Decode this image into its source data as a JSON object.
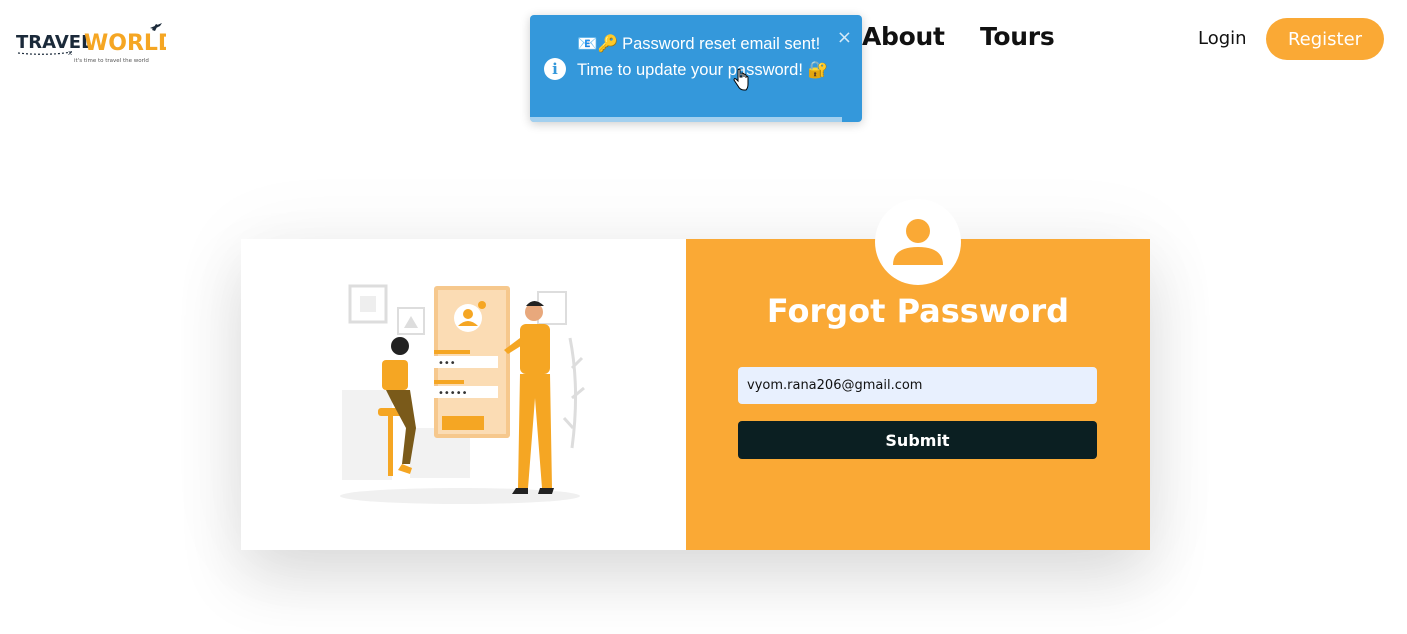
{
  "header": {
    "logo_text": "TRAVELWORLD",
    "logo_tagline": "it's time to travel the world",
    "nav": [
      {
        "label": "About"
      },
      {
        "label": "Tours"
      }
    ],
    "login_label": "Login",
    "register_label": "Register"
  },
  "toast": {
    "emoji_prefix": "📧🔑",
    "message": "Password reset email sent! Time to update your password!",
    "emoji_suffix": "🔐",
    "close_label": "×",
    "progress": 0.94,
    "color": "#3498db"
  },
  "form": {
    "title": "Forgot Password",
    "email_value": "vyom.rana206@gmail.com",
    "submit_label": "Submit"
  },
  "colors": {
    "accent": "#faa935",
    "dark": "#0b1f22",
    "input_bg": "#e8f0fe"
  }
}
